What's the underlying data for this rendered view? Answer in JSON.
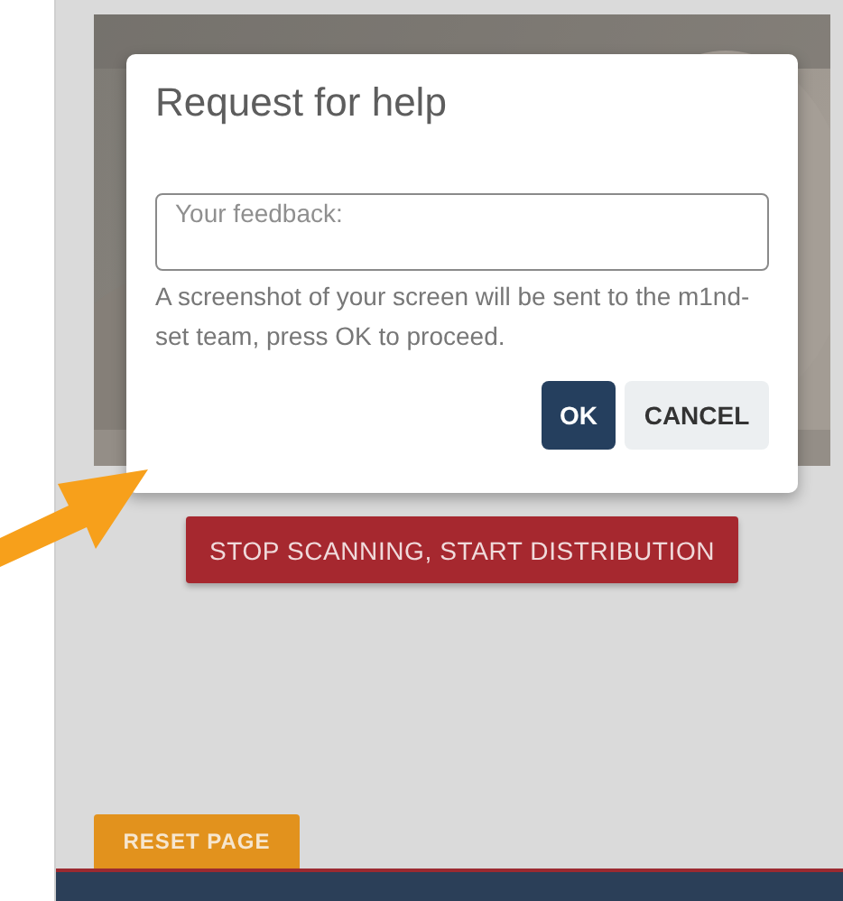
{
  "dialog": {
    "title": "Request for help",
    "feedback": {
      "placeholder": "Your feedback:"
    },
    "message": "A screenshot of your screen will be sent to the m1nd-set team, press OK to proceed.",
    "buttons": [
      {
        "label": "OK",
        "kind": "primary"
      },
      {
        "label": "CANCEL",
        "kind": "secondary"
      }
    ]
  },
  "main_button": {
    "label": "STOP SCANNING, START DISTRIBUTION"
  },
  "reset_button": {
    "label": "RESET PAGE"
  },
  "annotation": {
    "kind": "arrow"
  }
}
